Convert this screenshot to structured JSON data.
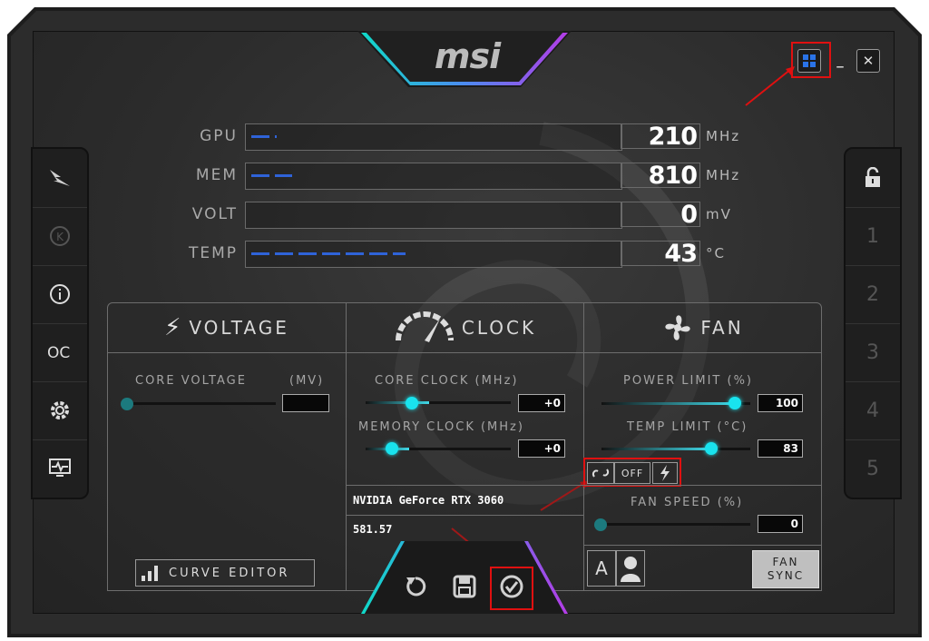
{
  "header": {
    "logo": "msi"
  },
  "window_controls": {
    "windows_icon": "windows-icon",
    "minimize": "_",
    "close": "✕"
  },
  "monitors": [
    {
      "label": "GPU",
      "value": "210",
      "unit": "MHz",
      "fill": 0.07
    },
    {
      "label": "MEM",
      "value": "810",
      "unit": "MHz",
      "fill": 0.11
    },
    {
      "label": "VOLT",
      "value": "0",
      "unit": "mV",
      "fill": 0
    },
    {
      "label": "TEMP",
      "value": "43",
      "unit": "°C",
      "fill": 0.43
    }
  ],
  "sidebar_left": [
    "msi-dragon-icon",
    "k-boost-icon",
    "info-icon",
    "oc-scanner-icon",
    "settings-gear-icon",
    "monitor-icon"
  ],
  "sidebar_right": {
    "lock_icon": "unlock-icon",
    "profiles": [
      "1",
      "2",
      "3",
      "4",
      "5"
    ]
  },
  "voltage": {
    "title": "VOLTAGE",
    "core_label": "CORE VOLTAGE",
    "core_unit": "(MV)",
    "value": "",
    "curve_editor": "CURVE EDITOR"
  },
  "clock": {
    "title": "CLOCK",
    "core_label": "CORE CLOCK (MHz)",
    "core_value": "+0",
    "mem_label": "MEMORY CLOCK (MHz)",
    "mem_value": "+0",
    "gpu_name": "NVIDIA GeForce RTX 3060",
    "driver": "581.57"
  },
  "fan": {
    "title": "FAN",
    "power_label": "POWER LIMIT (%)",
    "power_value": "100",
    "temp_label": "TEMP LIMIT (°C)",
    "temp_value": "83",
    "link_off": "OFF",
    "speed_label": "FAN SPEED (%)",
    "speed_value": "0",
    "auto": "A",
    "sync_line1": "FAN",
    "sync_line2": "SYNC"
  },
  "bottom": {
    "reset_icon": "reset-icon",
    "save_icon": "save-icon",
    "apply_icon": "apply-check-icon"
  },
  "colors": {
    "accent": "#19e3ee",
    "bar": "#2f63d8",
    "highlight": "#e01010"
  }
}
